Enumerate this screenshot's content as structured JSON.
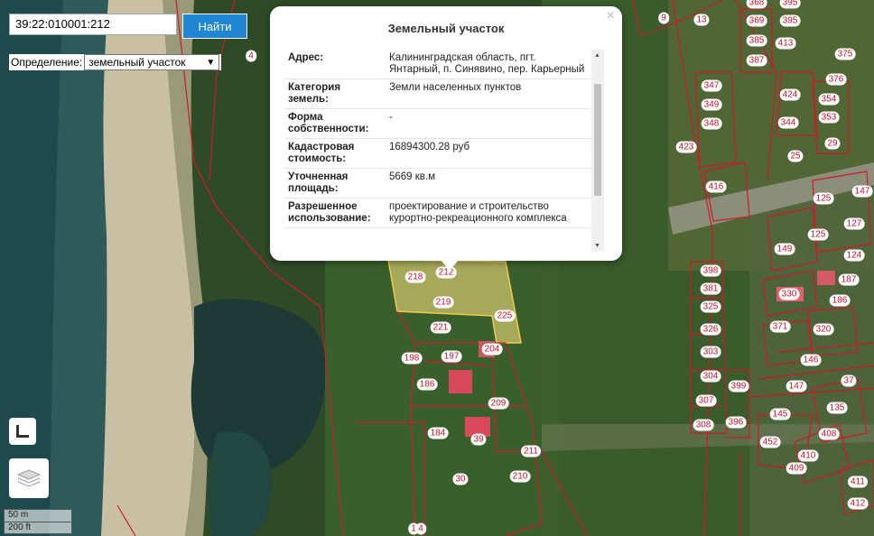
{
  "search": {
    "value": "39:22:010001:212",
    "button_label": "Найти"
  },
  "definition": {
    "label": "Определение:",
    "selected": "земельный участок"
  },
  "popup": {
    "title": "Земельный участок",
    "close": "×",
    "rows": [
      {
        "key": "Адрес:",
        "value": "Калининградская область, пгт. Янтарный, п. Синявино, пер. Карьерный"
      },
      {
        "key": "Категория земель:",
        "value": "Земли населенных пунктов"
      },
      {
        "key": "Форма собственности:",
        "value": "-"
      },
      {
        "key": "Кадастровая стоимость:",
        "value": "16894300.28 руб"
      },
      {
        "key": "Уточненная площадь:",
        "value": "5669 кв.м"
      },
      {
        "key": "Разрешенное использование:",
        "value": "проектирование и строительство курортно-рекреационного комплекса"
      }
    ]
  },
  "scale": {
    "metric": "50 m",
    "imperial": "200 ft"
  },
  "plot_labels": [
    "9",
    "13",
    "368",
    "395",
    "369",
    "395",
    "385",
    "413",
    "387",
    "375",
    "4",
    "347",
    "376",
    "349",
    "354",
    "348",
    "424",
    "353",
    "344",
    "423",
    "29",
    "25",
    "416",
    "125",
    "147",
    "127",
    "149",
    "125",
    "124",
    "398",
    "381",
    "187",
    "330",
    "325",
    "186",
    "371",
    "326",
    "320",
    "303",
    "146",
    "304",
    "399",
    "37",
    "307",
    "147",
    "135",
    "396",
    "308",
    "145",
    "408",
    "452",
    "410",
    "409",
    "411",
    "412",
    "218",
    "212",
    "219",
    "225",
    "221",
    "197",
    "204",
    "198",
    "186",
    "209",
    "184",
    "39",
    "211",
    "210",
    "30",
    "1",
    "4"
  ],
  "colors": {
    "boundary": "#d1182b",
    "highlight": "#ffe680",
    "label_text": "#c0132a",
    "accent": "#1f86d6"
  },
  "icons": {
    "measure": "ruler-corner-icon",
    "layers": "layers-icon"
  }
}
